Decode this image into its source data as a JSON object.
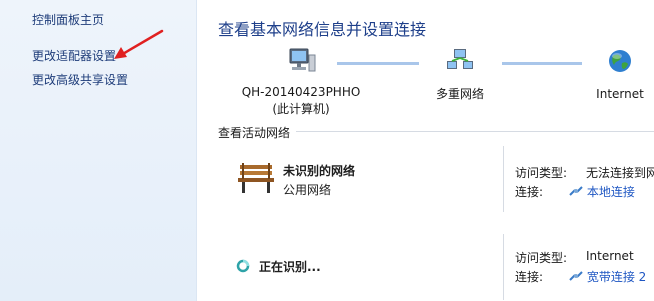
{
  "sidebar": {
    "home_label": "控制面板主页",
    "links": [
      "更改适配器设置",
      "更改高级共享设置"
    ]
  },
  "main": {
    "title": "查看基本网络信息并设置连接",
    "map": {
      "computer_name": "QH-20140423PHHO",
      "computer_sub": "(此计算机)",
      "middle_label": "多重网络",
      "internet_label": "Internet"
    },
    "active_section_title": "查看活动网络",
    "networks": [
      {
        "name": "未识别的网络",
        "type": "公用网络",
        "access_label": "访问类型:",
        "access_value": "无法连接到网",
        "conn_label": "连接:",
        "conn_value": "本地连接"
      },
      {
        "name": "正在识别...",
        "access_label": "访问类型:",
        "access_value": "Internet",
        "conn_label": "连接:",
        "conn_value": "宽带连接 2"
      }
    ]
  },
  "colors": {
    "sidebar_bg": "#e9f1fa",
    "title_blue": "#1e3f8a",
    "link_blue": "#1f57c3",
    "annotation_red": "#e02020"
  }
}
